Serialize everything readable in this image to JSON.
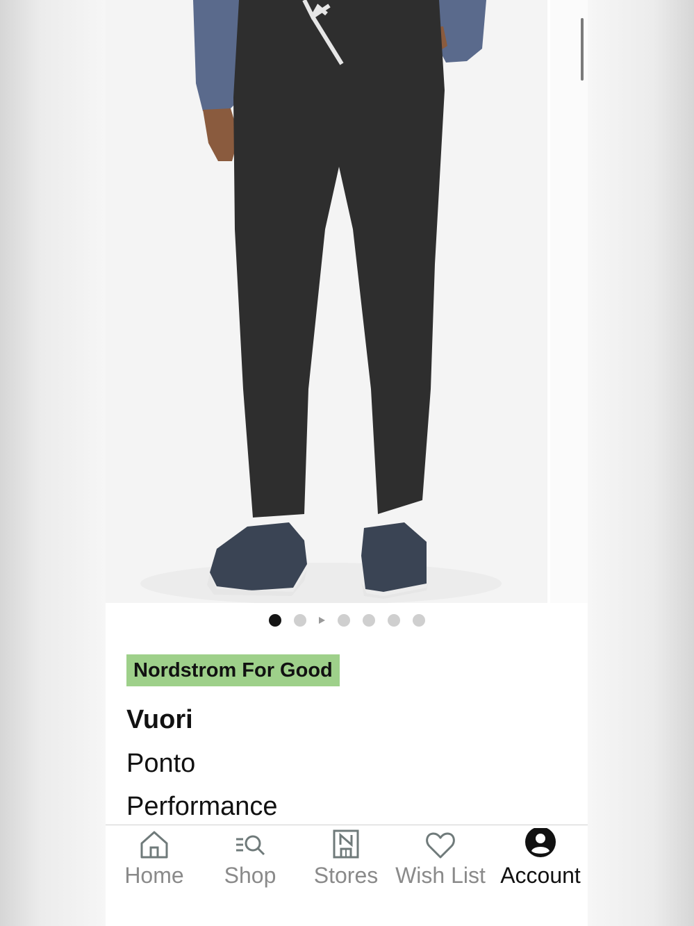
{
  "carousel": {
    "dot_count": 6,
    "active_index": 0,
    "video_indicator_after_index": 1
  },
  "product": {
    "badge": "Nordstrom For Good",
    "brand": "Vuori",
    "name_line_1": "Ponto",
    "name_line_2": "Performance"
  },
  "tabbar": {
    "items": [
      {
        "label": "Home",
        "icon": "home-icon"
      },
      {
        "label": "Shop",
        "icon": "shop-search-icon"
      },
      {
        "label": "Stores",
        "icon": "store-icon"
      },
      {
        "label": "Wish List",
        "icon": "heart-icon"
      },
      {
        "label": "Account",
        "icon": "account-icon"
      }
    ],
    "active_index": 4
  },
  "colors": {
    "badge_bg": "#9ed08a",
    "active_dot": "#151515",
    "inactive_dot": "#cfcfcf",
    "tab_inactive": "#8a8a8a",
    "tab_active": "#111111"
  }
}
